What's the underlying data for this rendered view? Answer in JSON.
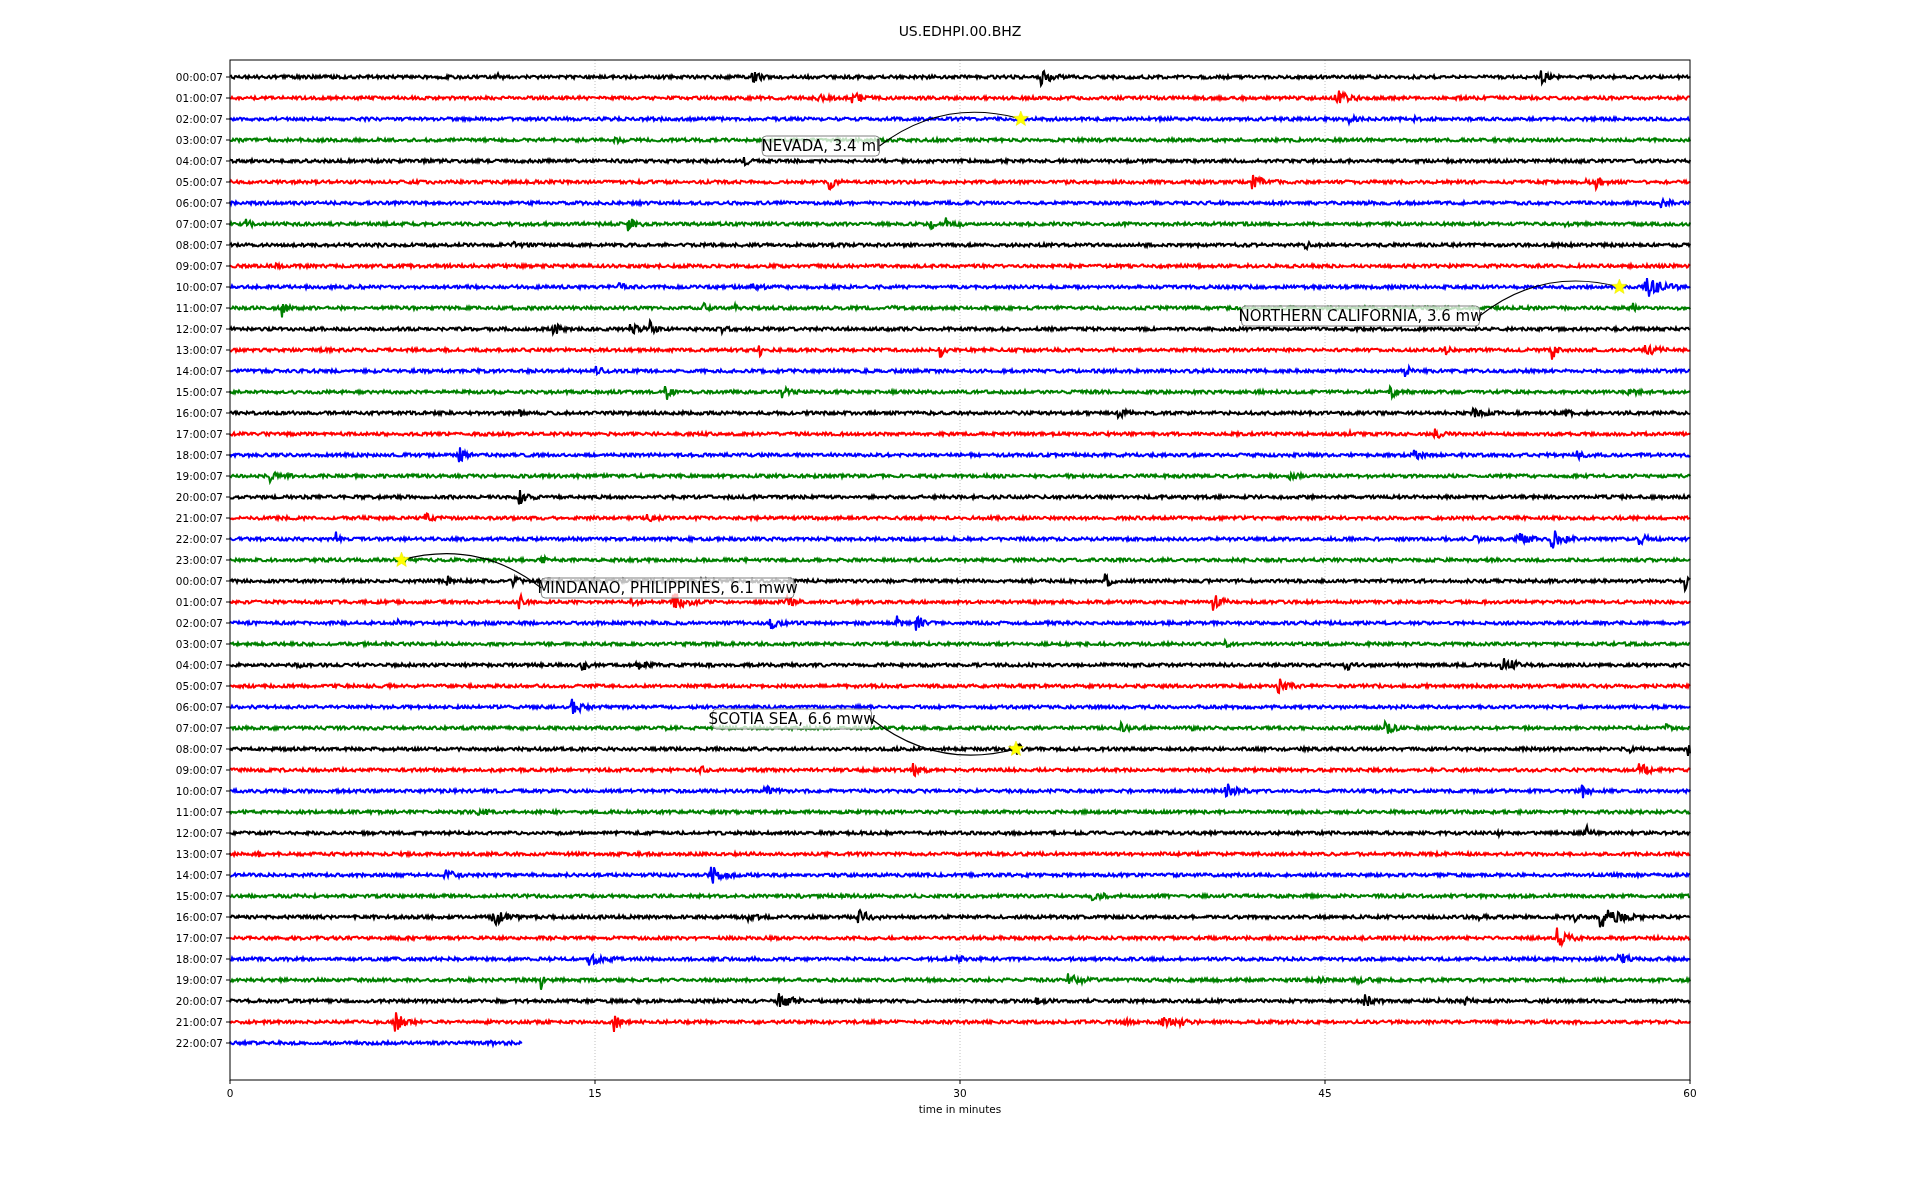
{
  "plot": {
    "title": "US.EDHPI.00.BHZ",
    "xlabel": "time in minutes",
    "xticks": [
      "0",
      "15",
      "30",
      "45",
      "60"
    ],
    "events": [
      {
        "text": "NEVADA, 3.4 ml"
      },
      {
        "text": "NORTHERN CALIFORNIA, 3.6 mw"
      },
      {
        "text": "MINDANAO, PHILIPPINES, 6.1 mww"
      },
      {
        "text": "SCOTIA SEA, 6.6 mww"
      }
    ]
  },
  "rows": [
    {
      "label": "00:00:07",
      "color": "#000000"
    },
    {
      "label": "01:00:07",
      "color": "#ff0000"
    },
    {
      "label": "02:00:07",
      "color": "#0000ff"
    },
    {
      "label": "03:00:07",
      "color": "#008000"
    },
    {
      "label": "04:00:07",
      "color": "#000000"
    },
    {
      "label": "05:00:07",
      "color": "#ff0000"
    },
    {
      "label": "06:00:07",
      "color": "#0000ff"
    },
    {
      "label": "07:00:07",
      "color": "#008000"
    },
    {
      "label": "08:00:07",
      "color": "#000000"
    },
    {
      "label": "09:00:07",
      "color": "#ff0000"
    },
    {
      "label": "10:00:07",
      "color": "#0000ff"
    },
    {
      "label": "11:00:07",
      "color": "#008000"
    },
    {
      "label": "12:00:07",
      "color": "#000000"
    },
    {
      "label": "13:00:07",
      "color": "#ff0000"
    },
    {
      "label": "14:00:07",
      "color": "#0000ff"
    },
    {
      "label": "15:00:07",
      "color": "#008000"
    },
    {
      "label": "16:00:07",
      "color": "#000000"
    },
    {
      "label": "17:00:07",
      "color": "#ff0000"
    },
    {
      "label": "18:00:07",
      "color": "#0000ff"
    },
    {
      "label": "19:00:07",
      "color": "#008000"
    },
    {
      "label": "20:00:07",
      "color": "#000000"
    },
    {
      "label": "21:00:07",
      "color": "#ff0000"
    },
    {
      "label": "22:00:07",
      "color": "#0000ff"
    },
    {
      "label": "23:00:07",
      "color": "#008000"
    },
    {
      "label": "00:00:07",
      "color": "#000000"
    },
    {
      "label": "01:00:07",
      "color": "#ff0000"
    },
    {
      "label": "02:00:07",
      "color": "#0000ff"
    },
    {
      "label": "03:00:07",
      "color": "#008000"
    },
    {
      "label": "04:00:07",
      "color": "#000000"
    },
    {
      "label": "05:00:07",
      "color": "#ff0000"
    },
    {
      "label": "06:00:07",
      "color": "#0000ff"
    },
    {
      "label": "07:00:07",
      "color": "#008000"
    },
    {
      "label": "08:00:07",
      "color": "#000000"
    },
    {
      "label": "09:00:07",
      "color": "#ff0000"
    },
    {
      "label": "10:00:07",
      "color": "#0000ff"
    },
    {
      "label": "11:00:07",
      "color": "#008000"
    },
    {
      "label": "12:00:07",
      "color": "#000000"
    },
    {
      "label": "13:00:07",
      "color": "#ff0000"
    },
    {
      "label": "14:00:07",
      "color": "#0000ff"
    },
    {
      "label": "15:00:07",
      "color": "#008000"
    },
    {
      "label": "16:00:07",
      "color": "#000000"
    },
    {
      "label": "17:00:07",
      "color": "#ff0000"
    },
    {
      "label": "18:00:07",
      "color": "#0000ff"
    },
    {
      "label": "19:00:07",
      "color": "#008000"
    },
    {
      "label": "20:00:07",
      "color": "#000000"
    },
    {
      "label": "21:00:07",
      "color": "#ff0000"
    },
    {
      "label": "22:00:07",
      "color": "#0000ff",
      "level": 0.2
    }
  ]
}
